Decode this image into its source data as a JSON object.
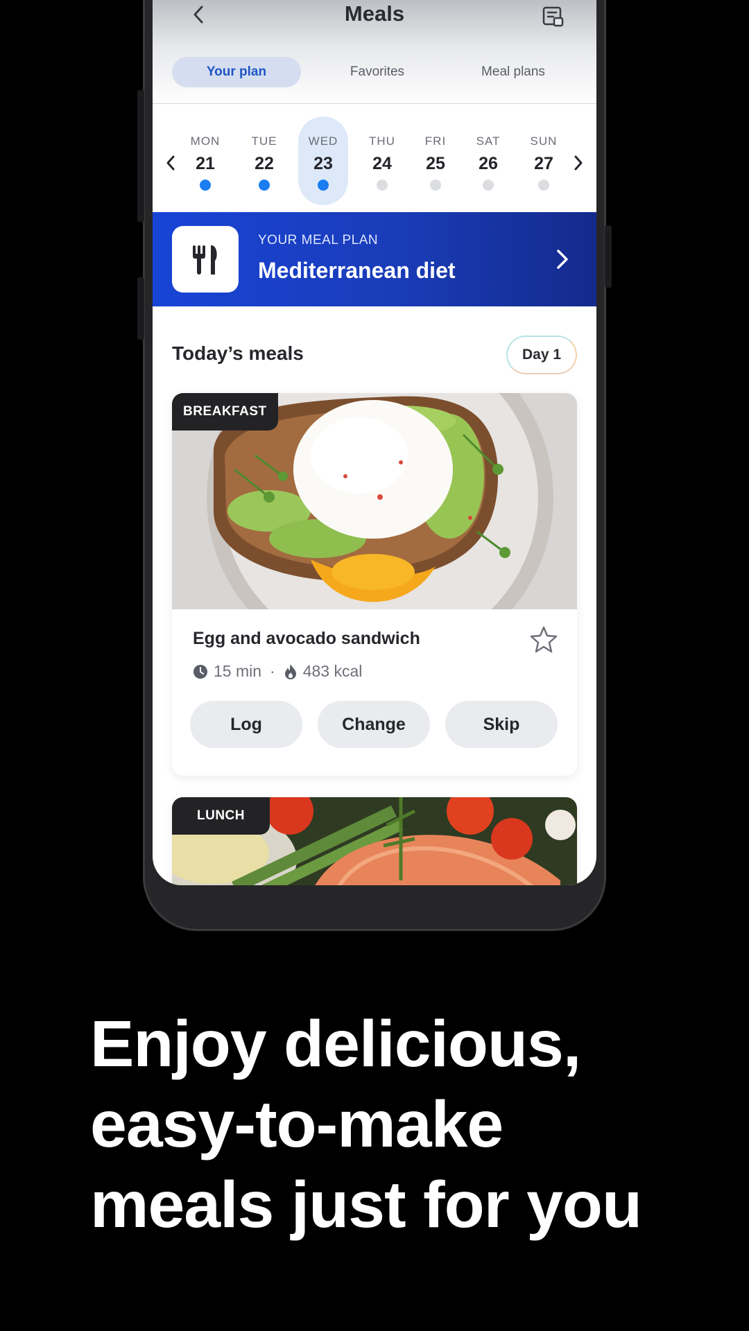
{
  "header": {
    "title": "Meals"
  },
  "tabs": [
    {
      "label": "Your plan",
      "active": true
    },
    {
      "label": "Favorites",
      "active": false
    },
    {
      "label": "Meal plans",
      "active": false
    }
  ],
  "week": {
    "days": [
      {
        "name": "MON",
        "num": "21",
        "logged": true
      },
      {
        "name": "TUE",
        "num": "22",
        "logged": true
      },
      {
        "name": "WED",
        "num": "23",
        "logged": true,
        "selected": true
      },
      {
        "name": "THU",
        "num": "24",
        "logged": false
      },
      {
        "name": "FRI",
        "num": "25",
        "logged": false
      },
      {
        "name": "SAT",
        "num": "26",
        "logged": false
      },
      {
        "name": "SUN",
        "num": "27",
        "logged": false
      }
    ]
  },
  "plan_banner": {
    "label": "YOUR MEAL PLAN",
    "title": "Mediterranean diet"
  },
  "today": {
    "title": "Today’s meals",
    "day_badge": "Day 1"
  },
  "meals": [
    {
      "tag": "BREAKFAST",
      "name": "Egg and avocado sandwich",
      "time": "15 min",
      "separator": "·",
      "kcal": "483 kcal",
      "actions": {
        "log": "Log",
        "change": "Change",
        "skip": "Skip"
      }
    },
    {
      "tag": "LUNCH"
    }
  ],
  "tagline": [
    "Enjoy delicious,",
    "easy-to-make",
    "meals just for you"
  ],
  "colors": {
    "accent": "#1a7df0",
    "banner": "#1844d6",
    "tab_active": "#1f55c4"
  }
}
